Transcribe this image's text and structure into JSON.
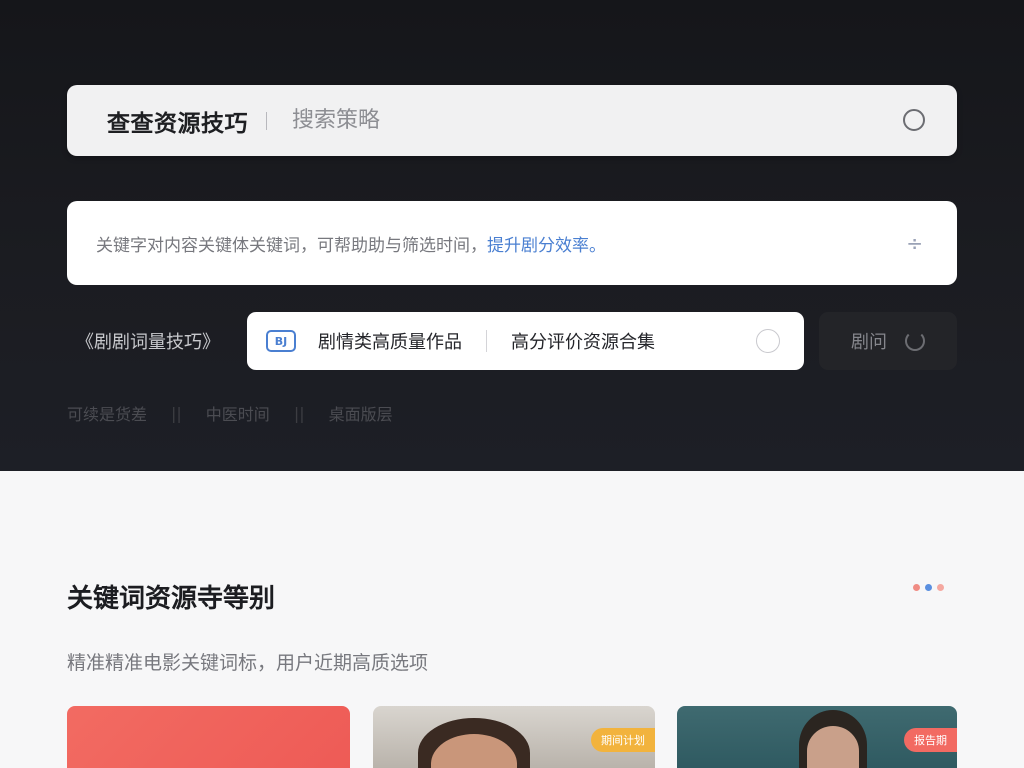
{
  "search": {
    "label": "查查资源技巧",
    "placeholder": "搜索策略"
  },
  "description": {
    "text": "关键字对内容关键体关键词，可帮助助与筛选时间，",
    "accent": "提升剧分效率。",
    "icon": "divide-icon"
  },
  "filter": {
    "bracket_label": "《剧剧词量技巧》",
    "chip_logo": "BJ",
    "chips": [
      "剧情类高质量作品",
      "高分评价资源合集"
    ],
    "refresh_label": "剧问"
  },
  "hints": [
    "可续是货差",
    "中医时间",
    "桌面版层"
  ],
  "section": {
    "title": "关键词资源寺等别",
    "subtitle": "精准精准电影关键词标，用户近期高质选项"
  },
  "cards": [
    {
      "badge": ""
    },
    {
      "badge": "期间计划"
    },
    {
      "badge": "报告期"
    }
  ],
  "colors": {
    "accent": "#4a7fd1",
    "hero_bg": "#17181c",
    "dot_1": "#f08c84",
    "dot_2": "#5a8fe0",
    "dot_3": "#f5a8a0",
    "badge_2": "#f2b33d",
    "badge_3": "#f26a62"
  }
}
